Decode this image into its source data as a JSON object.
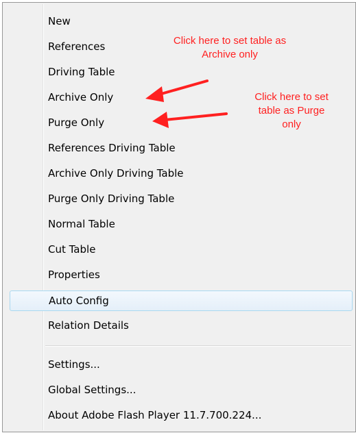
{
  "menu": {
    "items": [
      {
        "label": "New"
      },
      {
        "label": "References"
      },
      {
        "label": "Driving Table"
      },
      {
        "label": "Archive Only"
      },
      {
        "label": "Purge Only"
      },
      {
        "label": "References  Driving Table"
      },
      {
        "label": "Archive Only  Driving Table"
      },
      {
        "label": "Purge Only  Driving Table"
      },
      {
        "label": "Normal Table"
      },
      {
        "label": "Cut Table"
      },
      {
        "label": "Properties"
      },
      {
        "label": "Auto Config"
      },
      {
        "label": "Relation Details"
      },
      {
        "label": "Settings..."
      },
      {
        "label": "Global Settings..."
      },
      {
        "label": "About Adobe Flash Player 11.7.700.224..."
      }
    ],
    "highlighted_item": "Auto Config"
  },
  "annotations": {
    "archive": {
      "line1": "Click here to set table as",
      "line2": "Archive only"
    },
    "purge": {
      "line1": "Click here to set",
      "line2": "table as Purge",
      "line3": "only"
    },
    "color": "#ff2020"
  }
}
